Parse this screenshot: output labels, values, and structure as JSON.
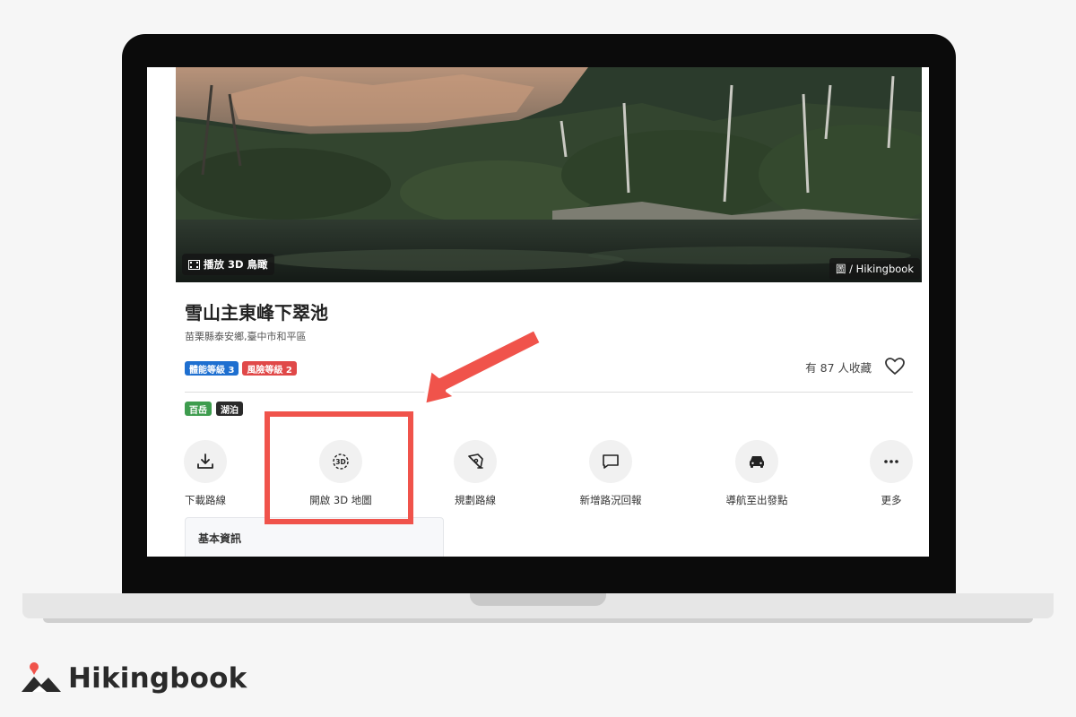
{
  "hero": {
    "play_3d_label": "播放 3D 鳥瞰",
    "credit": "圖 / Hikingbook"
  },
  "trail": {
    "title": "雪山主東峰下翠池",
    "location": "苗栗縣泰安鄉,臺中市和平區",
    "difficulty_tags": [
      "體能等級 3",
      "風險等級 2"
    ],
    "category_tags": [
      "百岳",
      "湖泊"
    ],
    "favorites_text": "有 87 人收藏"
  },
  "actions": [
    {
      "label": "下載路線",
      "icon": "download-icon"
    },
    {
      "label": "開啟 3D 地圖",
      "icon": "3d-map-icon"
    },
    {
      "label": "規劃路線",
      "icon": "pen-icon"
    },
    {
      "label": "新增路況回報",
      "icon": "chat-icon"
    },
    {
      "label": "導航至出發點",
      "icon": "car-icon"
    },
    {
      "label": "更多",
      "icon": "more-icon"
    }
  ],
  "info_card": {
    "title": "基本資訊"
  },
  "brand": {
    "name": "Hikingbook"
  },
  "colors": {
    "accent_red": "#f0534b",
    "tag_blue": "#1e6fd0",
    "tag_red": "#e04848",
    "tag_green": "#3e9c4e",
    "tag_dark": "#2a2a2a"
  }
}
